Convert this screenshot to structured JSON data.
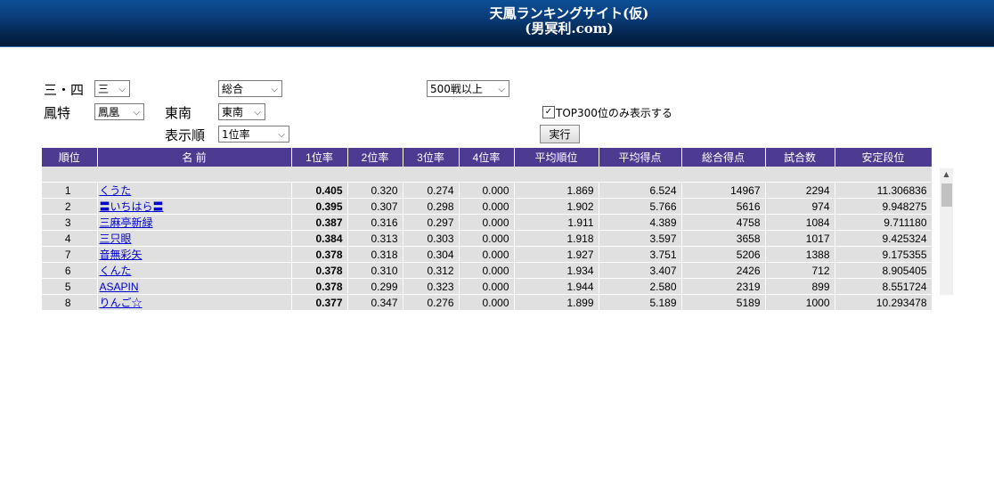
{
  "banner": {
    "line1": "天鳳ランキングサイト(仮)",
    "line2": "(男冥利.com)"
  },
  "filters": {
    "players_label": "三・四",
    "players_value": "三",
    "scope_value": "総合",
    "games_value": "500戦以上",
    "room_label": "鳳特",
    "room_value": "鳳凰",
    "rule_label": "東南",
    "rule_value": "東南",
    "sort_label": "表示順",
    "sort_value": "1位率",
    "top300_label": "TOP300位のみ表示する",
    "top300_checked": true,
    "run_label": "実行"
  },
  "table": {
    "headers": [
      "順位",
      "名 前",
      "1位率",
      "2位率",
      "3位率",
      "4位率",
      "平均順位",
      "平均得点",
      "総合得点",
      "試合数",
      "安定段位"
    ],
    "rows": [
      [
        "1",
        "くうた",
        "0.405",
        "0.320",
        "0.274",
        "0.000",
        "1.869",
        "6.524",
        "14967",
        "2294",
        "11.306836"
      ],
      [
        "2",
        "〓いちはら〓",
        "0.395",
        "0.307",
        "0.298",
        "0.000",
        "1.902",
        "5.766",
        "5616",
        "974",
        "9.948275"
      ],
      [
        "3",
        "三麻亭新緑",
        "0.387",
        "0.316",
        "0.297",
        "0.000",
        "1.911",
        "4.389",
        "4758",
        "1084",
        "9.711180"
      ],
      [
        "4",
        "三只眼",
        "0.384",
        "0.313",
        "0.303",
        "0.000",
        "1.918",
        "3.597",
        "3658",
        "1017",
        "9.425324"
      ],
      [
        "7",
        "音無彩矢",
        "0.378",
        "0.318",
        "0.304",
        "0.000",
        "1.927",
        "3.751",
        "5206",
        "1388",
        "9.175355"
      ],
      [
        "6",
        "くんた",
        "0.378",
        "0.310",
        "0.312",
        "0.000",
        "1.934",
        "3.407",
        "2426",
        "712",
        "8.905405"
      ],
      [
        "5",
        "ASAPIN",
        "0.378",
        "0.299",
        "0.323",
        "0.000",
        "1.944",
        "2.580",
        "2319",
        "899",
        "8.551724"
      ],
      [
        "8",
        "りんご☆",
        "0.377",
        "0.347",
        "0.276",
        "0.000",
        "1.899",
        "5.189",
        "5189",
        "1000",
        "10.293478"
      ]
    ]
  },
  "colors": {
    "header_bg": "#4d3b92",
    "row_bg": "#e0e0e0",
    "link": "#0000cc",
    "banner": "#0a3e7c"
  },
  "icons": {
    "dropdown": "chevron-down-icon",
    "checkbox": "checkmark-icon",
    "scroll_up": "scroll-up-arrow-icon"
  }
}
